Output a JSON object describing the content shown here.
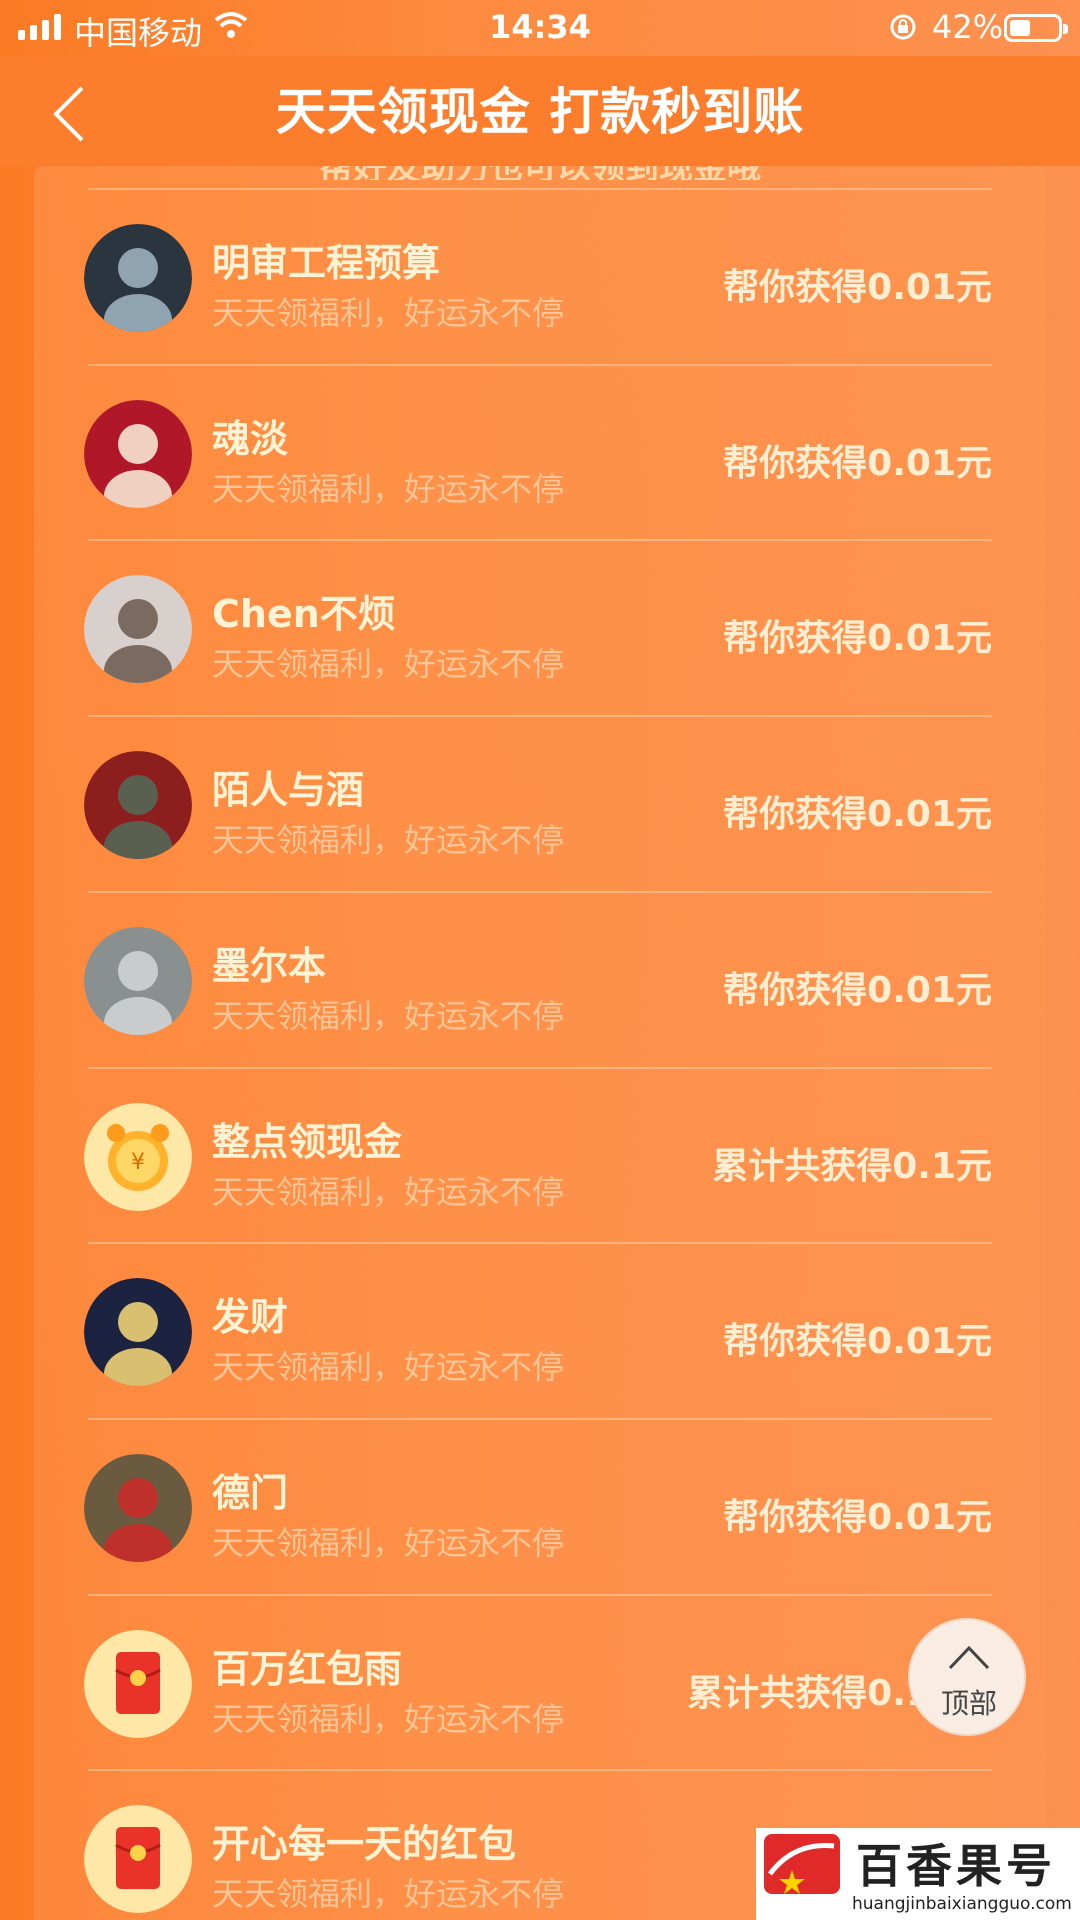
{
  "status_bar": {
    "carrier": "中国移动",
    "time": "14:34",
    "battery": "42%"
  },
  "nav": {
    "title": "天天领现金 打款秒到账"
  },
  "hint": "帮好友助力也可以领到现金哦",
  "list": [
    {
      "name": "明审工程预算",
      "subtitle": "天天领福利，好运永不停",
      "amount": "帮你获得0.01元",
      "avatar": "photo-avatar"
    },
    {
      "name": "魂淡",
      "subtitle": "天天领福利，好运永不停",
      "amount": "帮你获得0.01元",
      "avatar": "photo-avatar"
    },
    {
      "name": "Chen不烦",
      "subtitle": "天天领福利，好运永不停",
      "amount": "帮你获得0.01元",
      "avatar": "photo-avatar"
    },
    {
      "name": "陌人与酒",
      "subtitle": "天天领福利，好运永不停",
      "amount": "帮你获得0.01元",
      "avatar": "photo-avatar"
    },
    {
      "name": "墨尔本",
      "subtitle": "天天领福利，好运永不停",
      "amount": "帮你获得0.01元",
      "avatar": "photo-avatar"
    },
    {
      "name": "整点领现金",
      "subtitle": "天天领福利，好运永不停",
      "amount": "累计共获得0.1元",
      "avatar": "alarm-clock-icon"
    },
    {
      "name": "发财",
      "subtitle": "天天领福利，好运永不停",
      "amount": "帮你获得0.01元",
      "avatar": "photo-avatar"
    },
    {
      "name": "德门",
      "subtitle": "天天领福利，好运永不停",
      "amount": "帮你获得0.01元",
      "avatar": "photo-avatar"
    },
    {
      "name": "百万红包雨",
      "subtitle": "天天领福利，好运永不停",
      "amount": "累计共获得0.18元",
      "avatar": "red-envelope-icon"
    },
    {
      "name": "开心每一天的红包",
      "subtitle": "天天领福利，好运永不停",
      "amount": "",
      "avatar": "red-envelope-icon"
    }
  ],
  "top_button": {
    "label": "顶部"
  },
  "watermark": {
    "brand": "百香果号",
    "url": "huangjinbaixiangguo.com"
  }
}
